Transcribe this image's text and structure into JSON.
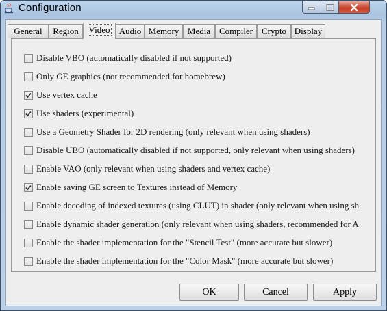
{
  "window": {
    "title": "Configuration",
    "icon": "java-cup-icon"
  },
  "tabs": [
    {
      "label": "General",
      "active": false
    },
    {
      "label": "Region",
      "active": false
    },
    {
      "label": "Video",
      "active": true
    },
    {
      "label": "Audio",
      "active": false
    },
    {
      "label": "Memory",
      "active": false
    },
    {
      "label": "Media",
      "active": false
    },
    {
      "label": "Compiler",
      "active": false
    },
    {
      "label": "Crypto",
      "active": false
    },
    {
      "label": "Display",
      "active": false
    }
  ],
  "options": [
    {
      "label": "Disable VBO (automatically disabled if not supported)",
      "checked": false
    },
    {
      "label": "Only GE graphics (not recommended for homebrew)",
      "checked": false
    },
    {
      "label": "Use vertex cache",
      "checked": true
    },
    {
      "label": "Use shaders (experimental)",
      "checked": true
    },
    {
      "label": "Use a Geometry Shader for 2D rendering (only relevant when using shaders)",
      "checked": false
    },
    {
      "label": "Disable UBO (automatically disabled if not supported, only relevant when using shaders)",
      "checked": false
    },
    {
      "label": "Enable VAO (only relevant when using shaders and vertex cache)",
      "checked": false
    },
    {
      "label": "Enable saving GE screen to Textures instead of Memory",
      "checked": true
    },
    {
      "label": "Enable decoding of indexed textures (using CLUT) in shader (only relevant when using sh",
      "checked": false
    },
    {
      "label": "Enable dynamic shader generation (only relevant when using shaders, recommended for A",
      "checked": false
    },
    {
      "label": "Enable the shader implementation for the \"Stencil Test\" (more accurate but slower)",
      "checked": false
    },
    {
      "label": "Enable the shader implementation for the \"Color Mask\" (more accurate but slower)",
      "checked": false
    }
  ],
  "buttons": {
    "ok": "OK",
    "cancel": "Cancel",
    "apply": "Apply"
  }
}
